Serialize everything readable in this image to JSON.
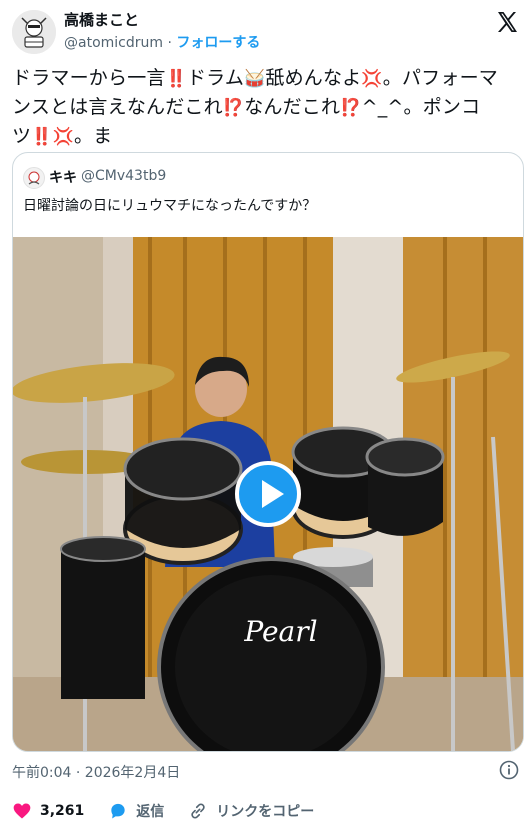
{
  "author": {
    "name": "高橋まこと",
    "handle": "@atomicdrum",
    "separator": "·",
    "follow_label": "フォローする"
  },
  "tweet": {
    "segments": [
      "ドラマーから一言",
      "ドラム",
      "舐めんなよ",
      "。パフォーマンスとは言えなんだこれ",
      "なんだこれ",
      "^_^。ポンコツ",
      "。ま"
    ],
    "emoji": {
      "double_exclamation": "‼️",
      "drum": "🥁",
      "anger": "💢",
      "interrobang": "⁉️"
    }
  },
  "quote": {
    "name": "キキ",
    "handle": "@CMv43tb9",
    "text": "日曜討論の日にリュウマチになったんですか？",
    "video_brand": "Pearl"
  },
  "meta": {
    "timestamp": "午前0:04 · 2026年2月4日"
  },
  "actions": {
    "likes": "3,261",
    "reply_label": "返信",
    "copy_link_label": "リンクをコピー"
  },
  "icons": [
    "avatar-drummer-icon",
    "x-logo-icon",
    "info-icon",
    "heart-icon",
    "reply-icon",
    "link-icon",
    "play-icon"
  ],
  "colors": {
    "accent": "#1d9bf0",
    "like": "#f91880",
    "secondary_text": "#536471"
  }
}
